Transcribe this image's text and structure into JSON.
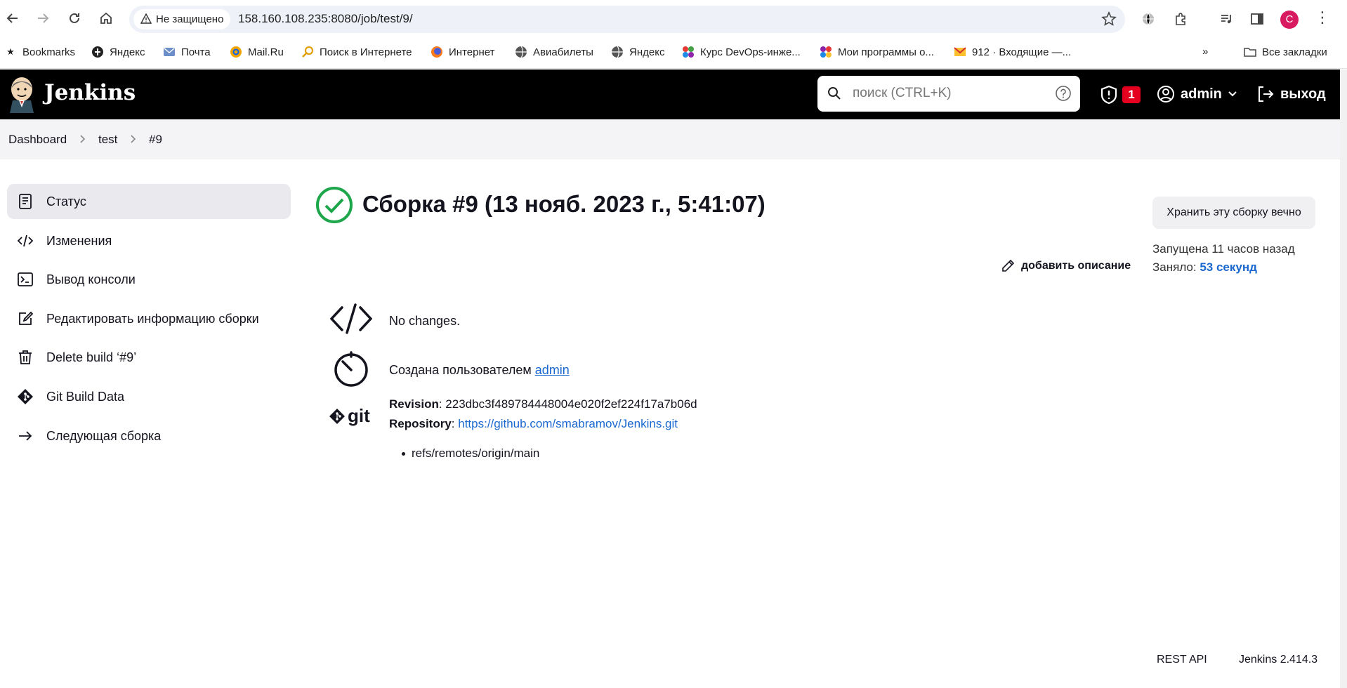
{
  "browser": {
    "security_chip": "Не защищено",
    "url": "158.160.108.235:8080/job/test/9/",
    "profile_initial": "C",
    "bookmarks": [
      {
        "label": "Bookmarks",
        "icon": "star-icon"
      },
      {
        "label": "Яндекс",
        "icon": "yandex-icon"
      },
      {
        "label": "Почта",
        "icon": "mail-icon"
      },
      {
        "label": "Mail.Ru",
        "icon": "mailru-icon"
      },
      {
        "label": "Поиск в Интернете",
        "icon": "search-icon"
      },
      {
        "label": "Интернет",
        "icon": "firefox-icon"
      },
      {
        "label": "Авиабилеты",
        "icon": "globe-icon"
      },
      {
        "label": "Яндекс",
        "icon": "globe-icon"
      },
      {
        "label": "Курс DevOps-инже...",
        "icon": "colorful-icon"
      },
      {
        "label": "Мои программы о...",
        "icon": "colorful-icon"
      },
      {
        "label": "912 · Входящие —...",
        "icon": "gmail-icon"
      }
    ],
    "all_bookmarks": "Все закладки",
    "more_bookmarks": "»"
  },
  "header": {
    "brand": "Jenkins",
    "search_placeholder": "поиск (CTRL+K)",
    "security_count": "1",
    "user": "admin",
    "logout": "выход"
  },
  "breadcrumb": [
    "Dashboard",
    "test",
    "#9"
  ],
  "sidebar": [
    {
      "label": "Статус",
      "icon": "status-icon",
      "active": true
    },
    {
      "label": "Изменения",
      "icon": "code-icon"
    },
    {
      "label": "Вывод консоли",
      "icon": "terminal-icon"
    },
    {
      "label": "Редактировать информацию сборки",
      "icon": "edit-icon"
    },
    {
      "label": "Delete build ‘#9’",
      "icon": "trash-icon"
    },
    {
      "label": "Git Build Data",
      "icon": "git-icon"
    },
    {
      "label": "Следующая сборка",
      "icon": "arrow-right-icon"
    }
  ],
  "build": {
    "title": "Сборка #9 (13 нояб. 2023 г., 5:41:07)",
    "keep_button": "Хранить эту сборку вечно",
    "started": "Запущена 11 часов назад",
    "took_label": "Заняло: ",
    "took_value": "53 секунд",
    "add_description": "добавить описание",
    "changes": "No changes.",
    "started_by_prefix": "Создана пользователем ",
    "started_by_user": "admin",
    "revision_label": "Revision",
    "revision_value": ": 223dbc3f489784448004e020f2ef224f17a7b06d",
    "repository_label": "Repository",
    "repository_sep": ": ",
    "repository_url": "https://github.com/smabramov/Jenkins.git",
    "branch": "refs/remotes/origin/main",
    "git_word": "git"
  },
  "footer": {
    "rest_api": "REST API",
    "version": "Jenkins 2.414.3"
  },
  "colors": {
    "header_bg": "#000000",
    "success": "#1ea64b",
    "link": "#1a68cf",
    "badge": "#e6001f"
  }
}
